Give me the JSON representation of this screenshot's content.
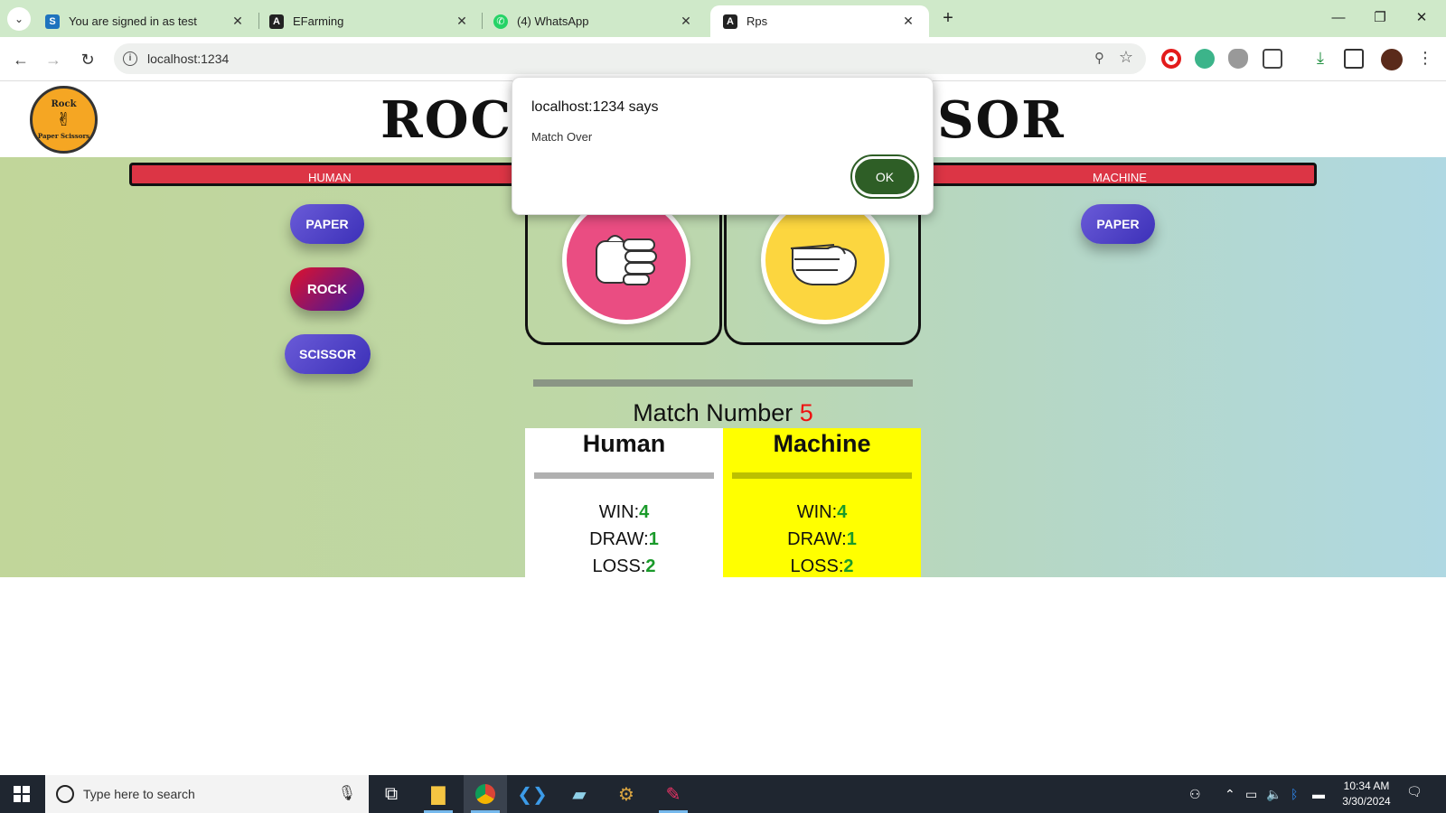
{
  "browser": {
    "tabs": [
      {
        "title": "You are signed in as test",
        "favicon": "s-icon",
        "active": false
      },
      {
        "title": "EFarming",
        "favicon": "angular-icon",
        "active": false
      },
      {
        "title": "(4) WhatsApp",
        "favicon": "whatsapp-icon",
        "active": false
      },
      {
        "title": "Rps",
        "favicon": "angular-icon",
        "active": true
      }
    ],
    "url": "localhost:1234"
  },
  "page": {
    "logo_top": "Rock",
    "logo_bottom": "Paper Scissors",
    "title_left": "ROC",
    "title_right": "SOR",
    "human_label": "HUMAN",
    "machine_label": "MACHINE",
    "human_choices": [
      "PAPER",
      "ROCK",
      "SCISSOR"
    ],
    "machine_choice": "PAPER",
    "match_label": "Match Number",
    "match_number": "5",
    "human_board": {
      "title": "Human",
      "win_label": "WIN:",
      "win": "4",
      "draw_label": "DRAW:",
      "draw": "1",
      "loss_label": "LOSS:",
      "loss": "2"
    },
    "machine_board": {
      "title": "Machine",
      "win_label": "WIN:",
      "win": "4",
      "draw_label": "DRAW:",
      "draw": "1",
      "loss_label": "LOSS:",
      "loss": "2"
    }
  },
  "dialog": {
    "title": "localhost:1234 says",
    "message": "Match Over",
    "ok_label": "OK"
  },
  "taskbar": {
    "search_placeholder": "Type here to search",
    "time": "10:34 AM",
    "date": "3/30/2024"
  },
  "colors": {
    "bar_red": "#dc3545",
    "ok_green": "#2e5e26",
    "machine_yellow": "#ffff00",
    "match_red": "#e11111",
    "score_green": "#1a9a2a"
  }
}
